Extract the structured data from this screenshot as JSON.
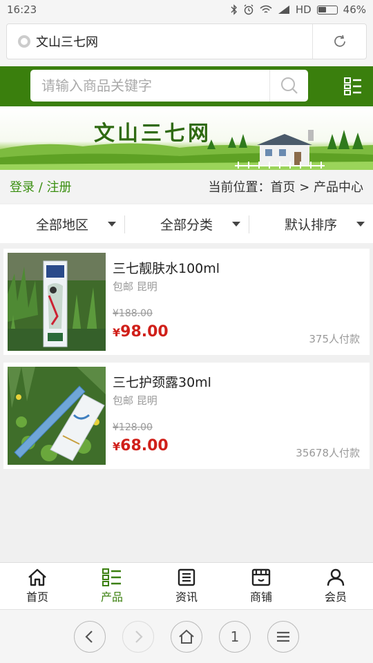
{
  "status_bar": {
    "time": "16:23",
    "network": "HD",
    "battery": "46%"
  },
  "browser": {
    "address": "文山三七网"
  },
  "search": {
    "placeholder": "请输入商品关键字"
  },
  "banner": {
    "title": "文山三七网"
  },
  "login": {
    "links": "登录 / 注册",
    "breadcrumb": "当前位置：首页 > 产品中心"
  },
  "filters": [
    "全部地区",
    "全部分类",
    "默认排序"
  ],
  "products": [
    {
      "name": "三七靓肤水100ml",
      "sub": "包邮 昆明",
      "old_price": "¥188.00",
      "currency": "¥",
      "price": "98.00",
      "sales": "375人付款"
    },
    {
      "name": "三七护颈露30ml",
      "sub": "包邮 昆明",
      "old_price": "¥128.00",
      "currency": "¥",
      "price": "68.00",
      "sales": "35678人付款"
    }
  ],
  "tabs": [
    {
      "label": "首页",
      "icon": "home-icon",
      "active": false
    },
    {
      "label": "产品",
      "icon": "product-list-icon",
      "active": true
    },
    {
      "label": "资讯",
      "icon": "news-icon",
      "active": false
    },
    {
      "label": "商铺",
      "icon": "store-icon",
      "active": false
    },
    {
      "label": "会员",
      "icon": "user-icon",
      "active": false
    }
  ],
  "browser_nav": {
    "tab_count": "1"
  },
  "colors": {
    "brand_green": "#3a7f0d",
    "price_red": "#d0201a"
  }
}
